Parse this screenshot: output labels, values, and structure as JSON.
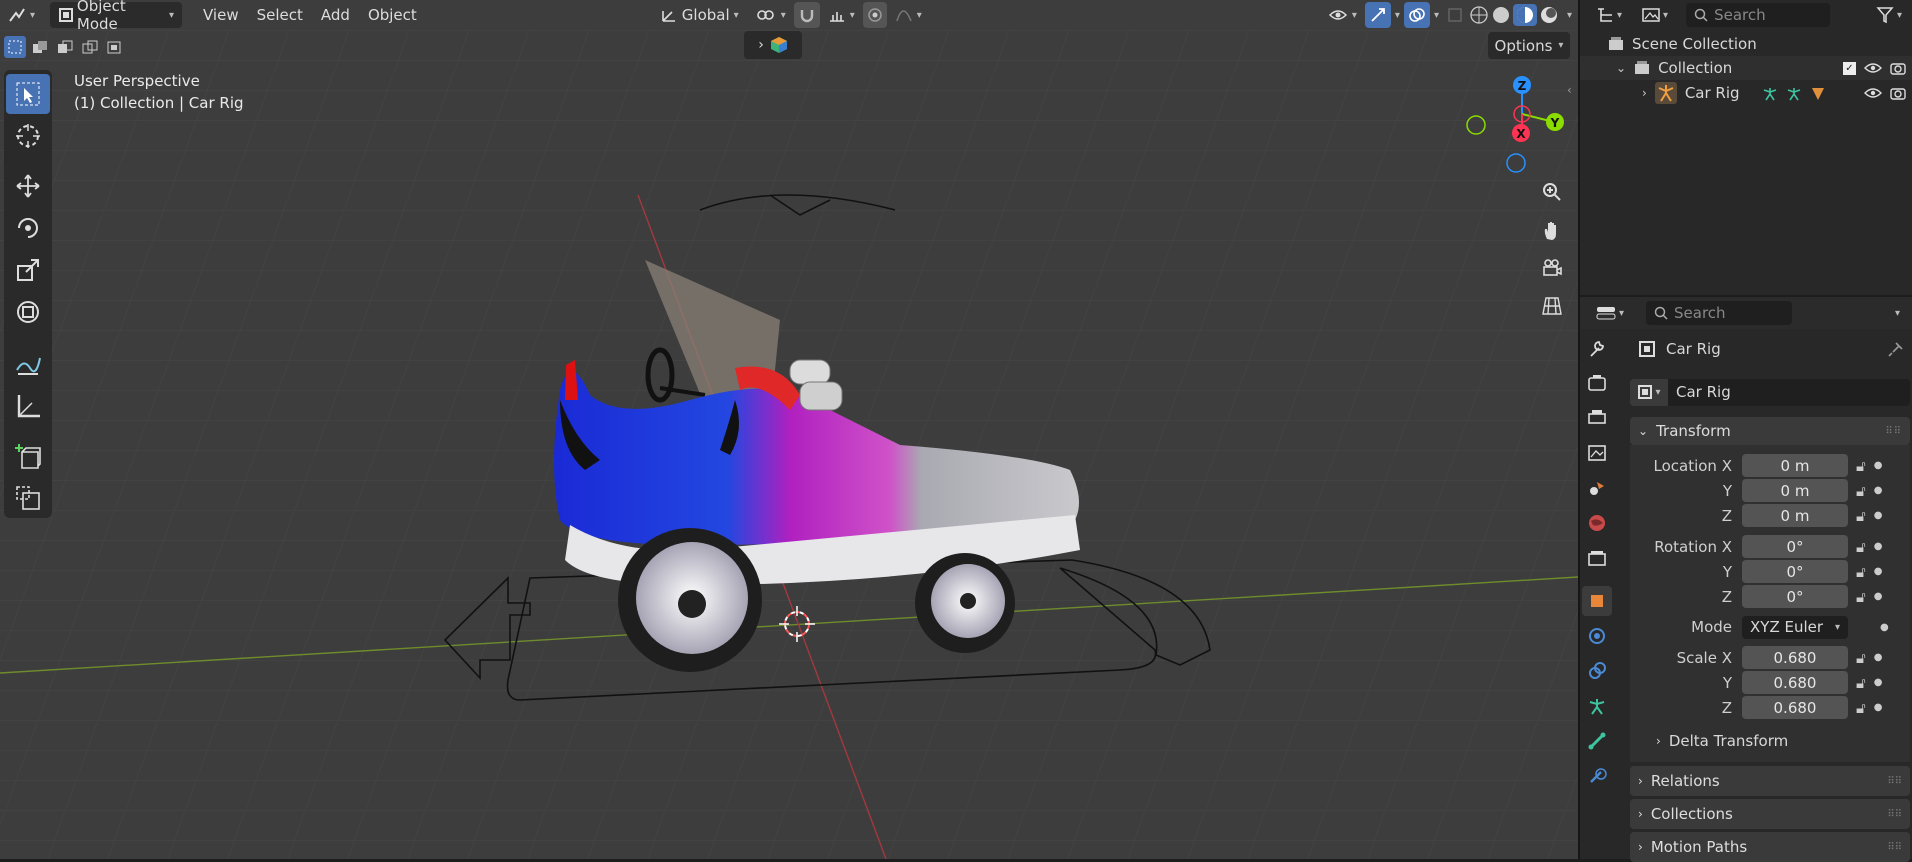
{
  "header": {
    "mode_label": "Object Mode",
    "menus": [
      "View",
      "Select",
      "Add",
      "Object"
    ],
    "orientation_label": "Global",
    "options_label": "Options"
  },
  "viewport": {
    "perspective_label": "User Perspective",
    "collection_label": "(1) Collection | Car Rig",
    "gizmo": {
      "z": "Z",
      "y": "Y",
      "x": "X"
    }
  },
  "outliner": {
    "search_placeholder": "Search",
    "scene_collection": "Scene Collection",
    "collection": "Collection",
    "object": "Car Rig"
  },
  "properties": {
    "search_placeholder": "Search",
    "object_title": "Car Rig",
    "object_name": "Car Rig",
    "transform_label": "Transform",
    "location_label": "Location X",
    "rotation_label": "Rotation X",
    "scale_label": "Scale X",
    "y_label": "Y",
    "z_label": "Z",
    "mode_label": "Mode",
    "location": [
      "0 m",
      "0 m",
      "0 m"
    ],
    "rotation": [
      "0°",
      "0°",
      "0°"
    ],
    "scale": [
      "0.680",
      "0.680",
      "0.680"
    ],
    "rotation_mode": "XYZ Euler",
    "delta_transform": "Delta Transform",
    "relations": "Relations",
    "collections": "Collections",
    "motion_paths": "Motion Paths"
  },
  "colors": {
    "accent": "#4772b3",
    "viewport_bg": "#3d3d3d",
    "panel_bg": "#282828",
    "field_bg": "#545454",
    "axis_x": "#ff3352",
    "axis_y": "#8bdc00",
    "axis_z": "#2890ff"
  }
}
